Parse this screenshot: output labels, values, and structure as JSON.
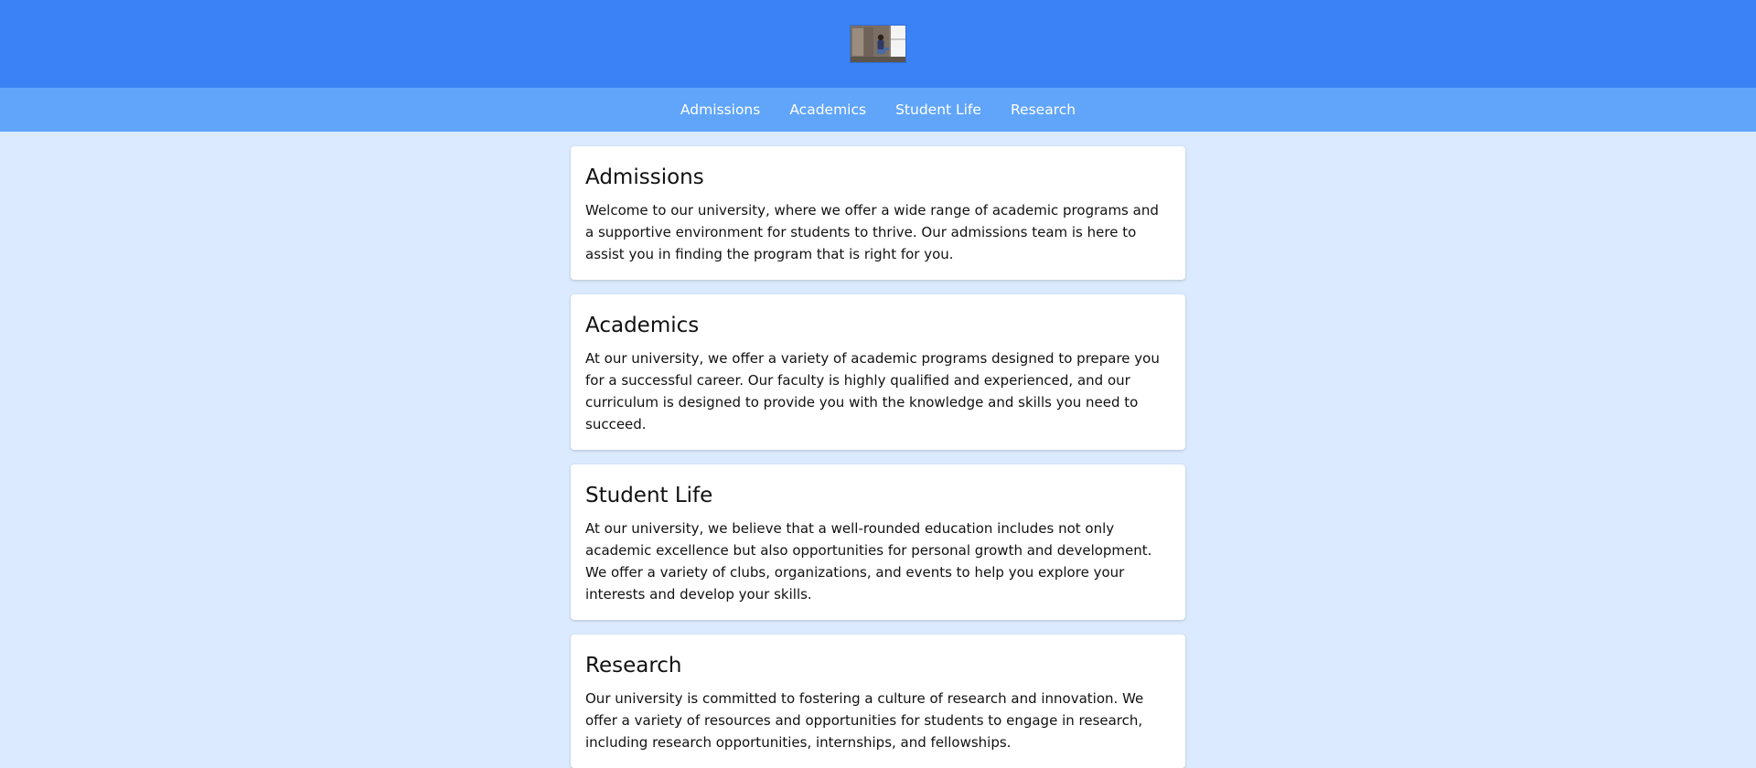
{
  "header": {
    "logo_icon": "campus-photo-logo"
  },
  "nav": {
    "items": [
      {
        "label": "Admissions"
      },
      {
        "label": "Academics"
      },
      {
        "label": "Student Life"
      },
      {
        "label": "Research"
      }
    ]
  },
  "sections": [
    {
      "title": "Admissions",
      "body": "Welcome to our university, where we offer a wide range of academic programs and a supportive environment for students to thrive. Our admissions team is here to assist you in finding the program that is right for you."
    },
    {
      "title": "Academics",
      "body": "At our university, we offer a variety of academic programs designed to prepare you for a successful career. Our faculty is highly qualified and experienced, and our curriculum is designed to provide you with the knowledge and skills you need to succeed."
    },
    {
      "title": "Student Life",
      "body": "At our university, we believe that a well-rounded education includes not only academic excellence but also opportunities for personal growth and development. We offer a variety of clubs, organizations, and events to help you explore your interests and develop your skills."
    },
    {
      "title": "Research",
      "body": "Our university is committed to fostering a culture of research and innovation. We offer a variety of resources and opportunities for students to engage in research, including research opportunities, internships, and fellowships."
    }
  ],
  "colors": {
    "header_bg": "#3b82f6",
    "nav_bg": "#60a5fa",
    "page_bg": "#dbeafe",
    "card_bg": "#ffffff"
  }
}
